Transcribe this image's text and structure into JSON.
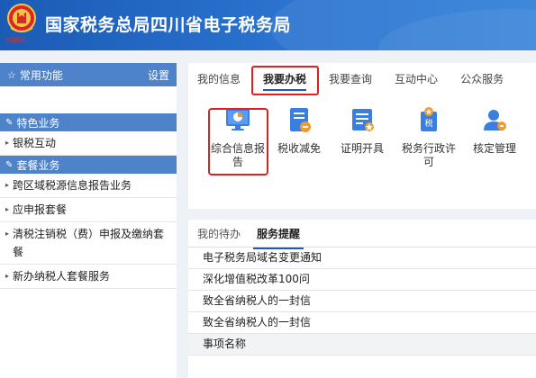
{
  "header": {
    "title": "国家税务总局四川省电子税务局",
    "emblem_text": "中国税务"
  },
  "sidebar": {
    "common": {
      "label": "常用功能",
      "settings": "设置"
    },
    "sections": [
      {
        "title": "特色业务",
        "items": [
          "银税互动"
        ]
      },
      {
        "title": "套餐业务",
        "items": [
          "跨区域税源信息报告业务",
          "应申报套餐",
          "清税注销税（费）申报及缴纳套餐",
          "新办纳税人套餐服务"
        ]
      }
    ]
  },
  "top_tabs": [
    "我的信息",
    "我要办税",
    "我要查询",
    "互动中心",
    "公众服务"
  ],
  "active_top_tab": "我要办税",
  "tiles": [
    {
      "label": "综合信息报告",
      "icon": "monitor-report-icon"
    },
    {
      "label": "税收减免",
      "icon": "tax-relief-icon"
    },
    {
      "label": "证明开具",
      "icon": "certificate-icon"
    },
    {
      "label": "税务行政许可",
      "icon": "tax-license-icon"
    },
    {
      "label": "核定管理",
      "icon": "assessment-user-icon"
    }
  ],
  "bottom_tabs": [
    "我的待办",
    "服务提醒"
  ],
  "active_bottom_tab": "服务提醒",
  "notices": [
    "电子税务局域名变更通知",
    "深化增值税改革100问",
    "致全省纳税人的一封信",
    "致全省纳税人的一封信"
  ],
  "table_header": "事项名称",
  "colors": {
    "brand_blue": "#1a5bb5",
    "highlight_red": "#e02020",
    "sidebar_bar": "#4e83c9"
  }
}
